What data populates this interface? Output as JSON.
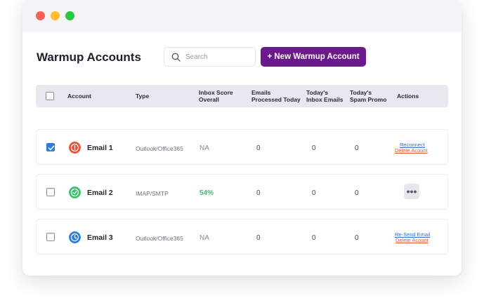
{
  "window": {
    "controls": [
      "close",
      "minimize",
      "maximize"
    ]
  },
  "header": {
    "title": "Warmup Accounts",
    "search_placeholder": "Search",
    "new_button_label": "+ New Warmup Account"
  },
  "table": {
    "columns": {
      "account": "Account",
      "type": "Type",
      "inbox_score_1": "Inbox Score",
      "inbox_score_2": "Overall",
      "emails_processed_1": "Emails",
      "emails_processed_2": "Processed Today",
      "inbox_emails_1": "Today's",
      "inbox_emails_2": "Inbox Emails",
      "spam_promo_1": "Today's",
      "spam_promo_2": "Spam Promo",
      "actions": "Actions"
    },
    "rows": [
      {
        "checked": true,
        "status_icon": "error-icon",
        "status_color": "#e4533a",
        "name": "Email 1",
        "type": "Outlook/Office365",
        "score": "NA",
        "processed": "0",
        "inbox": "0",
        "spam": "0",
        "action_1": "Reconnect",
        "action_2": "Delete Acount"
      },
      {
        "checked": false,
        "status_icon": "check-circle-icon",
        "status_color": "#3bbf6b",
        "name": "Email 2",
        "type": "IMAP/SMTP",
        "score": "54%",
        "processed": "0",
        "inbox": "0",
        "spam": "0",
        "more_label": "•••"
      },
      {
        "checked": false,
        "status_icon": "clock-icon",
        "status_color": "#2d7fd3",
        "name": "Email 3",
        "type": "Outlook/Office365",
        "score": "NA",
        "processed": "0",
        "inbox": "0",
        "spam": "0",
        "action_1": "Re-Send Email",
        "action_2": "Delete Acount"
      }
    ]
  },
  "colors": {
    "accent": "#6a1a8a",
    "header_bg": "#e8e9f0",
    "link_blue": "#2d6fd3",
    "link_red": "#e4533a",
    "score_good": "#3bbf6b"
  }
}
